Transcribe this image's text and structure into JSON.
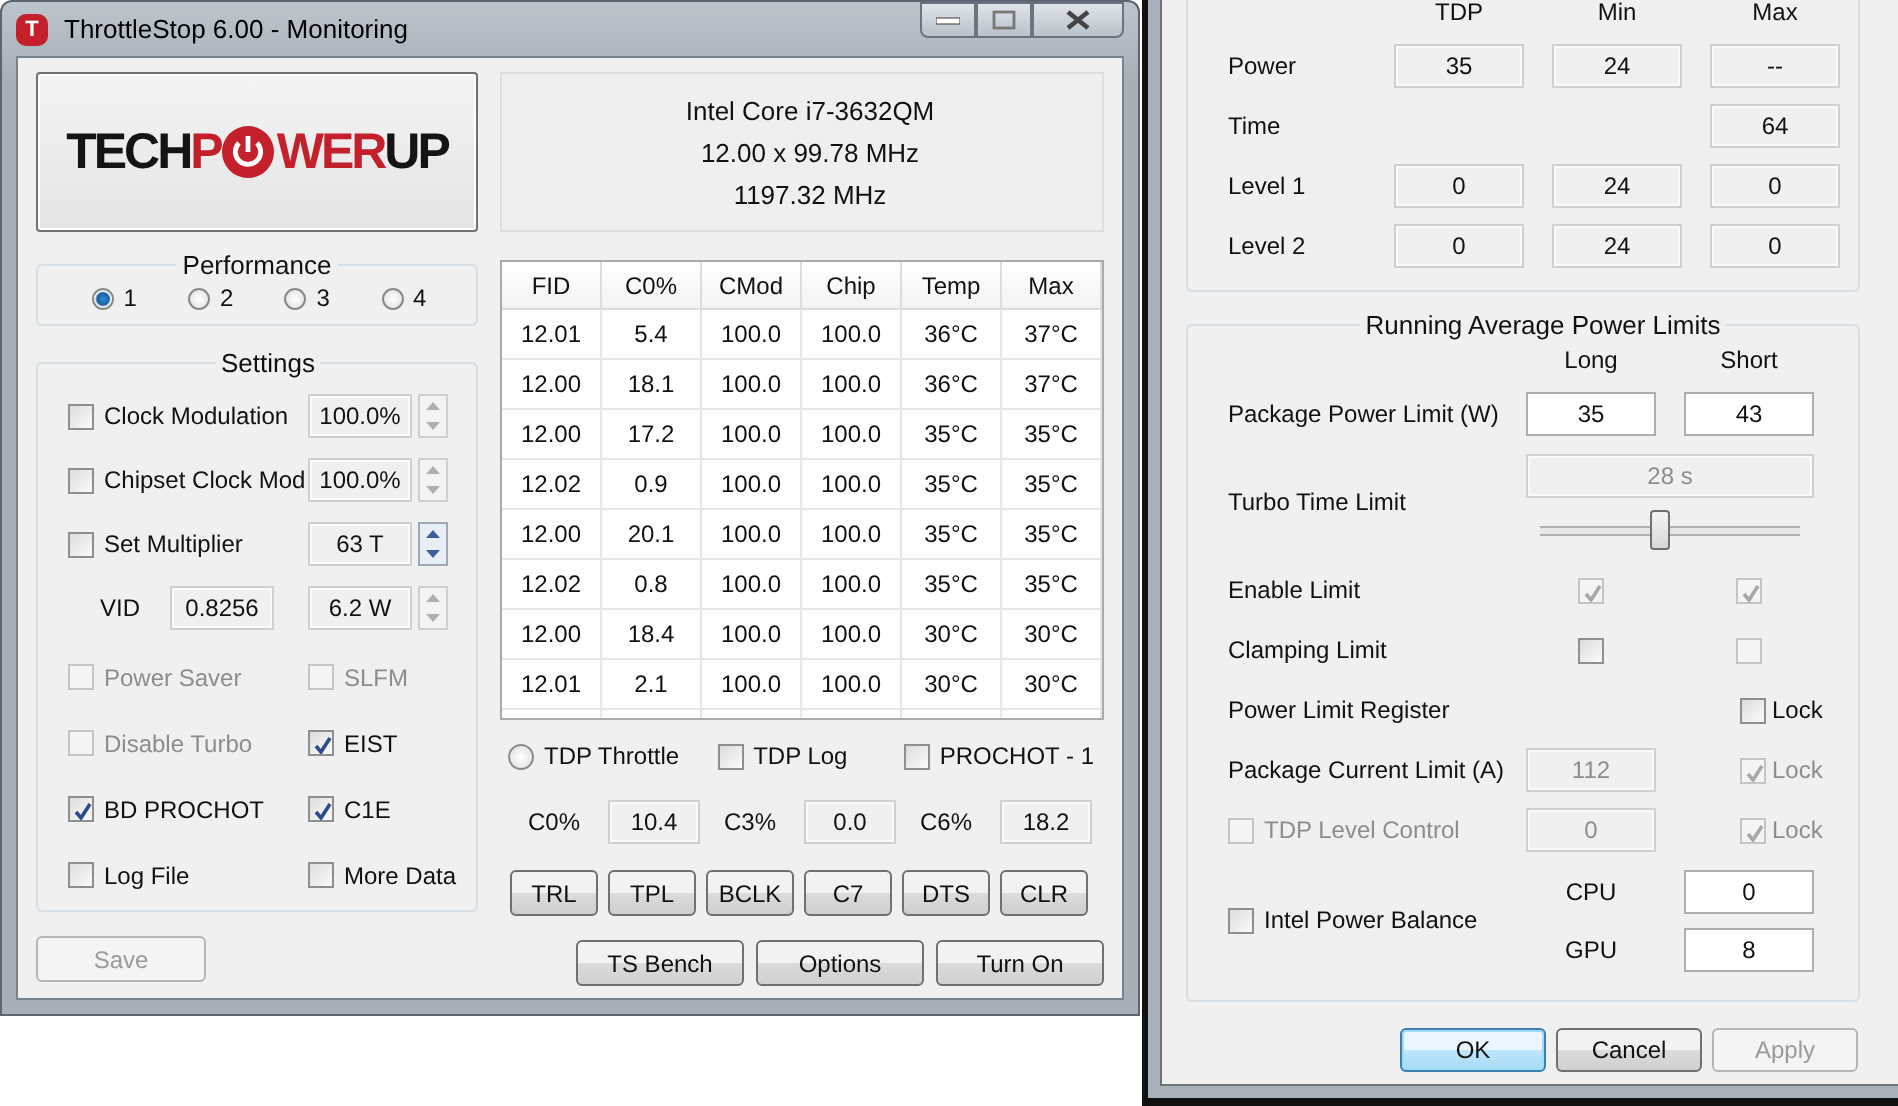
{
  "main_window": {
    "icon_letter": "T",
    "title": "ThrottleStop 6.00 - Monitoring",
    "logo": {
      "parts_before": [
        {
          "text": "TECH",
          "color": "#141414"
        },
        {
          "text": "P",
          "color": "#c4202b"
        }
      ],
      "parts_after": [
        {
          "text": "WER",
          "color": "#c4202b"
        },
        {
          "text": "UP",
          "color": "#141414"
        }
      ]
    },
    "cpu_info": [
      "Intel Core i7-3632QM",
      "12.00 x 99.78 MHz",
      "1197.32 MHz"
    ],
    "performance": {
      "title": "Performance",
      "options": [
        {
          "label": "1",
          "selected": true
        },
        {
          "label": "2",
          "selected": false
        },
        {
          "label": "3",
          "selected": false
        },
        {
          "label": "4",
          "selected": false
        }
      ]
    },
    "settings": {
      "title": "Settings",
      "rows": [
        {
          "kind": "spin",
          "label": "Clock Modulation",
          "checked": false,
          "value": "100.0%",
          "spinner_enabled": false
        },
        {
          "kind": "spin",
          "label": "Chipset Clock Mod",
          "checked": false,
          "value": "100.0%",
          "spinner_enabled": false
        },
        {
          "kind": "spin",
          "label": "Set Multiplier",
          "checked": false,
          "value": "63 T",
          "spinner_enabled": true
        },
        {
          "kind": "vid",
          "label": "VID",
          "vid": "0.8256",
          "value": "6.2 W",
          "spinner_enabled": false
        }
      ],
      "checks": [
        {
          "label": "Power Saver",
          "checked": false,
          "disabled": true
        },
        {
          "label": "SLFM",
          "checked": false,
          "disabled": true
        },
        {
          "label": "Disable Turbo",
          "checked": false,
          "disabled": true
        },
        {
          "label": "EIST",
          "checked": true,
          "disabled": false
        },
        {
          "label": "BD PROCHOT",
          "checked": true,
          "disabled": false
        },
        {
          "label": "C1E",
          "checked": true,
          "disabled": false
        },
        {
          "label": "Log File",
          "checked": false,
          "disabled": false
        },
        {
          "label": "More Data",
          "checked": false,
          "disabled": false
        }
      ]
    },
    "save_button": {
      "label": "Save",
      "disabled": true
    },
    "table": {
      "columns": [
        "FID",
        "C0%",
        "CMod",
        "Chip",
        "Temp",
        "Max"
      ],
      "rows": [
        [
          "12.01",
          "5.4",
          "100.0",
          "100.0",
          "36°C",
          "37°C"
        ],
        [
          "12.00",
          "18.1",
          "100.0",
          "100.0",
          "36°C",
          "37°C"
        ],
        [
          "12.00",
          "17.2",
          "100.0",
          "100.0",
          "35°C",
          "35°C"
        ],
        [
          "12.02",
          "0.9",
          "100.0",
          "100.0",
          "35°C",
          "35°C"
        ],
        [
          "12.00",
          "20.1",
          "100.0",
          "100.0",
          "35°C",
          "35°C"
        ],
        [
          "12.02",
          "0.8",
          "100.0",
          "100.0",
          "35°C",
          "35°C"
        ],
        [
          "12.00",
          "18.4",
          "100.0",
          "100.0",
          "30°C",
          "30°C"
        ],
        [
          "12.01",
          "2.1",
          "100.0",
          "100.0",
          "30°C",
          "30°C"
        ]
      ]
    },
    "options": [
      {
        "kind": "radio",
        "label": "TDP Throttle",
        "selected": false
      },
      {
        "kind": "checkbox",
        "label": "TDP Log",
        "checked": false
      },
      {
        "kind": "checkbox",
        "label": "PROCHOT - 1",
        "checked": false
      }
    ],
    "c_states": [
      {
        "label": "C0%",
        "value": "10.4"
      },
      {
        "label": "C3%",
        "value": "0.0"
      },
      {
        "label": "C6%",
        "value": "18.2"
      }
    ],
    "tool_buttons": [
      "TRL",
      "TPL",
      "BCLK",
      "C7",
      "DTS",
      "CLR"
    ],
    "action_buttons": [
      "TS Bench",
      "Options",
      "Turn On"
    ]
  },
  "limits_window": {
    "power_table": {
      "columns": [
        "TDP",
        "Min",
        "Max"
      ],
      "rows": [
        {
          "label": "Power",
          "tdp": "35",
          "min": "24",
          "max": "--"
        },
        {
          "label": "Time",
          "max": "64"
        },
        {
          "label": "Level 1",
          "tdp": "0",
          "min": "24",
          "max": "0"
        },
        {
          "label": "Level 2",
          "tdp": "0",
          "min": "24",
          "max": "0"
        }
      ]
    },
    "rapl": {
      "title": "Running Average Power Limits",
      "columns": [
        "Long",
        "Short"
      ],
      "rows": [
        {
          "kind": "fields",
          "label": "Package Power Limit (W)",
          "values": [
            "35",
            "43"
          ]
        },
        {
          "kind": "time",
          "label": "Turbo Time Limit",
          "value": "28 s",
          "level": 0.47
        },
        {
          "kind": "checks",
          "label": "Enable Limit",
          "checks": [
            {
              "checked": true,
              "disabled": true
            },
            {
              "checked": true,
              "disabled": true
            }
          ]
        },
        {
          "kind": "checks",
          "label": "Clamping Limit",
          "checks": [
            {
              "checked": false,
              "disabled": false
            },
            {
              "checked": false,
              "disabled": true
            }
          ]
        },
        {
          "kind": "lock",
          "label": "Power Limit Register",
          "lock": {
            "label": "Lock",
            "checked": false,
            "disabled": false
          }
        },
        {
          "kind": "lock",
          "label": "Package Current Limit (A)",
          "value": "112",
          "lock": {
            "label": "Lock",
            "checked": true,
            "disabled": true
          }
        },
        {
          "kind": "lock",
          "label": "TDP Level Control",
          "label_checkbox": {
            "checked": false,
            "disabled": true
          },
          "value": "0",
          "lock": {
            "label": "Lock",
            "checked": true,
            "disabled": true
          }
        },
        {
          "kind": "balance",
          "label": "Intel Power Balance",
          "checked": false,
          "fields": [
            {
              "label": "CPU",
              "value": "0"
            },
            {
              "label": "GPU",
              "value": "8"
            }
          ]
        }
      ]
    },
    "buttons": [
      {
        "label": "OK",
        "default": true,
        "disabled": false
      },
      {
        "label": "Cancel",
        "default": false,
        "disabled": false
      },
      {
        "label": "Apply",
        "default": false,
        "disabled": true
      }
    ]
  }
}
